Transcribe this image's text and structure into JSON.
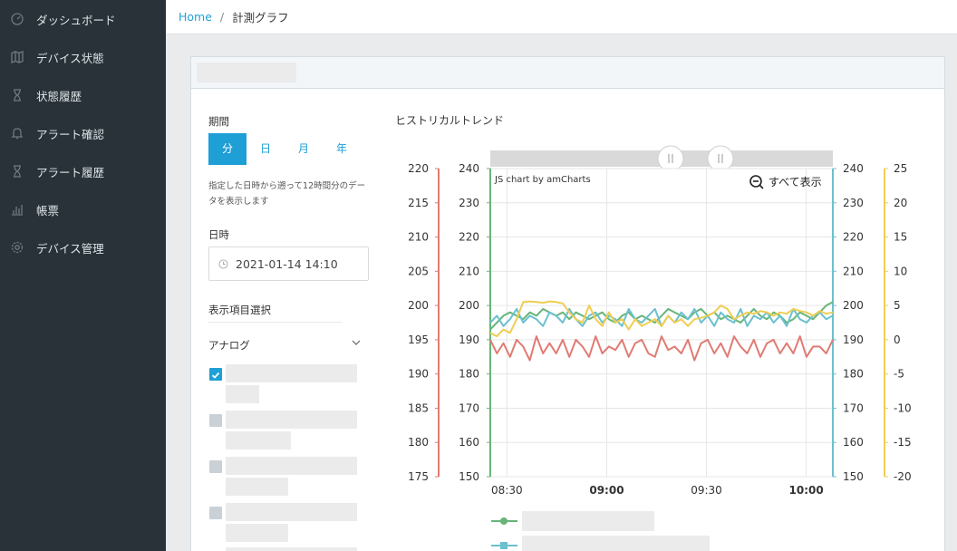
{
  "sidebar": {
    "items": [
      {
        "label": "ダッシュボード",
        "icon": "dashboard-gauge-icon"
      },
      {
        "label": "デバイス状態",
        "icon": "map-icon"
      },
      {
        "label": "状態履歴",
        "icon": "hourglass-icon"
      },
      {
        "label": "アラート確認",
        "icon": "bell-icon"
      },
      {
        "label": "アラート履歴",
        "icon": "hourglass-icon"
      },
      {
        "label": "帳票",
        "icon": "bar-chart-icon"
      },
      {
        "label": "デバイス管理",
        "icon": "gear-icon"
      }
    ]
  },
  "breadcrumb": {
    "home": "Home",
    "separator": "/",
    "current": "計測グラフ"
  },
  "panel": {
    "period_label": "期間",
    "period_options": [
      "分",
      "日",
      "月",
      "年"
    ],
    "period_selected": "分",
    "hint": "指定した日時から遡って12時間分のデータを表示します",
    "datetime_label": "日時",
    "datetime_value": "2021-01-14 14:10",
    "items_label": "表示項目選択",
    "group_label": "アナログ"
  },
  "chart_title": "ヒストリカルトレンド",
  "colors": {
    "accent": "#1e9fd6",
    "red": "#e07b73",
    "green": "#67b578",
    "teal": "#6cc0cf",
    "yellow": "#f0cd53"
  },
  "chart_data": {
    "type": "line",
    "credit": "JS chart by amCharts",
    "zoom_out_label": "すべて表示",
    "x_ticks": [
      {
        "label": "08:30",
        "t": 0,
        "bold": false
      },
      {
        "label": "09:00",
        "t": 30,
        "bold": true
      },
      {
        "label": "09:30",
        "t": 60,
        "bold": false
      },
      {
        "label": "10:00",
        "t": 90,
        "bold": true
      }
    ],
    "x_range_minutes": [
      -5,
      98
    ],
    "axes": [
      {
        "id": "red",
        "side": "left-outer",
        "color": "#e07b73",
        "ylim": [
          175,
          220
        ],
        "ticks": [
          175,
          180,
          185,
          190,
          195,
          200,
          205,
          210,
          215,
          220
        ]
      },
      {
        "id": "green",
        "side": "left-inner",
        "color": "#67b578",
        "ylim": [
          150,
          240
        ],
        "ticks": [
          150,
          160,
          170,
          180,
          190,
          200,
          210,
          220,
          230,
          240
        ]
      },
      {
        "id": "teal",
        "side": "right-inner",
        "color": "#6cc0cf",
        "ylim": [
          150,
          240
        ],
        "ticks": [
          150,
          160,
          170,
          180,
          190,
          200,
          210,
          220,
          230,
          240
        ]
      },
      {
        "id": "yellow",
        "side": "right-outer",
        "color": "#f0cd53",
        "ylim": [
          -20,
          25
        ],
        "ticks": [
          -20,
          -15,
          -10,
          -5,
          0,
          5,
          10,
          15,
          20,
          25
        ]
      }
    ],
    "series": [
      {
        "axis": "red",
        "color": "#e07b73",
        "y": [
          195,
          193,
          194.5,
          192.5,
          195,
          194,
          192,
          195.5,
          193,
          194.5,
          193,
          195,
          192.5,
          195,
          194,
          192.5,
          195.5,
          193,
          194,
          193.5,
          195,
          192.5,
          194.5,
          195,
          193,
          192.5,
          195.5,
          193.5,
          194,
          193,
          195,
          192,
          194.5,
          195,
          193,
          194.5,
          192.5,
          195.5,
          194,
          193,
          195,
          192.5,
          194.5,
          195,
          193,
          194.5,
          193,
          195.5,
          192.5,
          194,
          194,
          193,
          195
        ]
      },
      {
        "axis": "green",
        "color": "#67b578",
        "y": [
          193,
          195,
          197,
          198,
          197,
          196,
          198,
          197,
          199,
          198,
          197,
          198,
          196,
          198,
          197,
          196,
          197,
          198,
          196,
          195,
          197,
          198,
          196,
          197,
          196,
          195,
          197,
          199,
          198,
          197,
          196,
          198,
          199,
          197,
          198,
          196,
          197,
          196,
          195,
          197,
          199,
          197,
          196,
          198,
          197,
          195,
          196,
          198,
          197,
          196,
          198,
          200,
          201
        ]
      },
      {
        "axis": "teal",
        "color": "#6cc0cf",
        "y": [
          195,
          197,
          194,
          196,
          199,
          195,
          197,
          196,
          194,
          198,
          197,
          195,
          199,
          196,
          194,
          197,
          198,
          195,
          197,
          196,
          194,
          199,
          196,
          195,
          197,
          199,
          194,
          197,
          195,
          198,
          196,
          199,
          195,
          197,
          194,
          198,
          196,
          195,
          199,
          194,
          197,
          196,
          198,
          195,
          197,
          194,
          199,
          196,
          195,
          197,
          198,
          196,
          197
        ]
      },
      {
        "axis": "yellow",
        "color": "#f0cd53",
        "y": [
          1,
          0.5,
          1.5,
          1,
          3,
          5.5,
          5.6,
          5.5,
          5.4,
          5.6,
          5.5,
          5.3,
          4,
          3,
          2.5,
          5,
          3,
          2,
          4,
          2.5,
          3,
          1.5,
          3,
          2,
          2.5,
          3,
          2,
          3.5,
          2.5,
          3,
          2,
          3,
          3.2,
          3.5,
          4,
          5,
          4.5,
          3,
          3.5,
          4,
          3.8,
          4.2,
          4,
          3.5,
          4,
          3.8,
          4.5,
          4.2,
          4,
          3.5,
          4.2,
          3.8,
          4
        ]
      }
    ],
    "legend": [
      {
        "color": "#67b578",
        "marker": "circle"
      },
      {
        "color": "#6cc0cf",
        "marker": "square"
      }
    ]
  }
}
